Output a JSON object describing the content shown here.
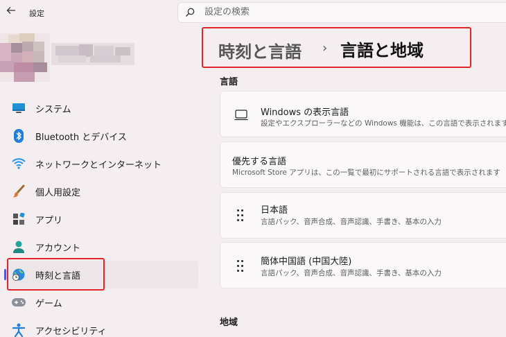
{
  "titlebar": {
    "back_icon": "back-arrow-icon",
    "title": "設定"
  },
  "search": {
    "placeholder": "設定の検索",
    "value": ""
  },
  "nav": {
    "items": [
      {
        "label": "システム",
        "icon": "system-icon"
      },
      {
        "label": "Bluetooth とデバイス",
        "icon": "bluetooth-icon"
      },
      {
        "label": "ネットワークとインターネット",
        "icon": "wifi-icon"
      },
      {
        "label": "個人用設定",
        "icon": "brush-icon"
      },
      {
        "label": "アプリ",
        "icon": "apps-icon"
      },
      {
        "label": "アカウント",
        "icon": "account-icon"
      },
      {
        "label": "時刻と言語",
        "icon": "globe-clock-icon",
        "active": true
      },
      {
        "label": "ゲーム",
        "icon": "gamepad-icon"
      },
      {
        "label": "アクセシビリティ",
        "icon": "accessibility-icon"
      }
    ]
  },
  "breadcrumb": {
    "parent": "時刻と言語",
    "separator": "›",
    "current": "言語と地域"
  },
  "language_section": {
    "title": "言語",
    "display_language": {
      "title": "Windows の表示言語",
      "subtitle": "設定やエクスプローラーなどの Windows 機能は、この言語で表示されます。"
    },
    "preferred": {
      "title": "優先する言語",
      "subtitle": "Microsoft Store アプリは、この一覧で最初にサポートされる言語で表示されます"
    },
    "languages": [
      {
        "title": "日本語",
        "subtitle": "言語パック、音声合成、音声認識、手書き、基本の入力"
      },
      {
        "title": "簡体中国語 (中国大陸)",
        "subtitle": "言語パック、音声合成、音声認識、手書き、基本の入力"
      }
    ]
  },
  "region_section": {
    "title": "地域"
  },
  "colors": {
    "accent": "#4f5bd5",
    "highlight": "#e0242c",
    "background": "#f4eef1"
  }
}
